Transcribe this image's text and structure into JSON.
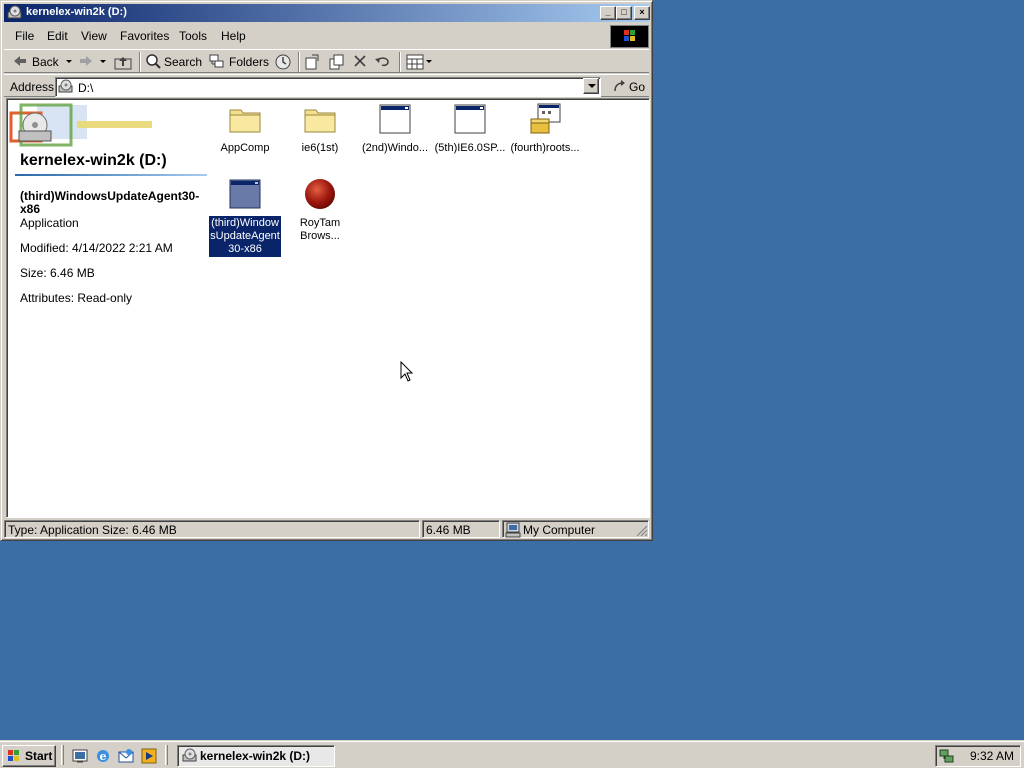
{
  "window": {
    "title": "kernelex-win2k (D:)",
    "minimize_glyph": "_",
    "maximize_glyph": "□",
    "close_glyph": "×"
  },
  "menu": [
    "File",
    "Edit",
    "View",
    "Favorites",
    "Tools",
    "Help"
  ],
  "toolbar": {
    "back": "Back",
    "search": "Search",
    "folders": "Folders"
  },
  "address": {
    "label": "Address",
    "value": "D:\\",
    "go": "Go"
  },
  "left_pane": {
    "drive_title": "kernelex-win2k (D:)",
    "selected_name": "(third)WindowsUpdateAgent30-x86",
    "type": "Application",
    "modified": "Modified: 4/14/2022 2:21 AM",
    "size": "Size: 6.46 MB",
    "attributes": "Attributes: Read-only"
  },
  "files": [
    {
      "name": "AppComp",
      "icon": "folder-icon"
    },
    {
      "name": "ie6(1st)",
      "icon": "folder-icon"
    },
    {
      "name": "(2nd)Windo...",
      "icon": "window-app-icon"
    },
    {
      "name": "(5th)IE6.0SP...",
      "icon": "window-app-icon"
    },
    {
      "name": "(fourth)roots...",
      "icon": "installer-icon"
    },
    {
      "name": "(third)WindowsUpdateAgent30-x86",
      "icon": "window-app-icon",
      "selected": true
    },
    {
      "name": "RoyTam Brows...",
      "icon": "red-ball-icon"
    }
  ],
  "status": {
    "main": "Type: Application Size: 6.46 MB",
    "size": "6.46 MB",
    "zone": "My Computer"
  },
  "taskbar": {
    "start": "Start",
    "task": "kernelex-win2k (D:)",
    "clock": "9:32 AM"
  },
  "colors": {
    "desktop": "#3a6ea5",
    "titlebar_start": "#0a246a",
    "titlebar_end": "#a6caf0",
    "selection": "#0a246a",
    "face": "#d4d0c8"
  }
}
